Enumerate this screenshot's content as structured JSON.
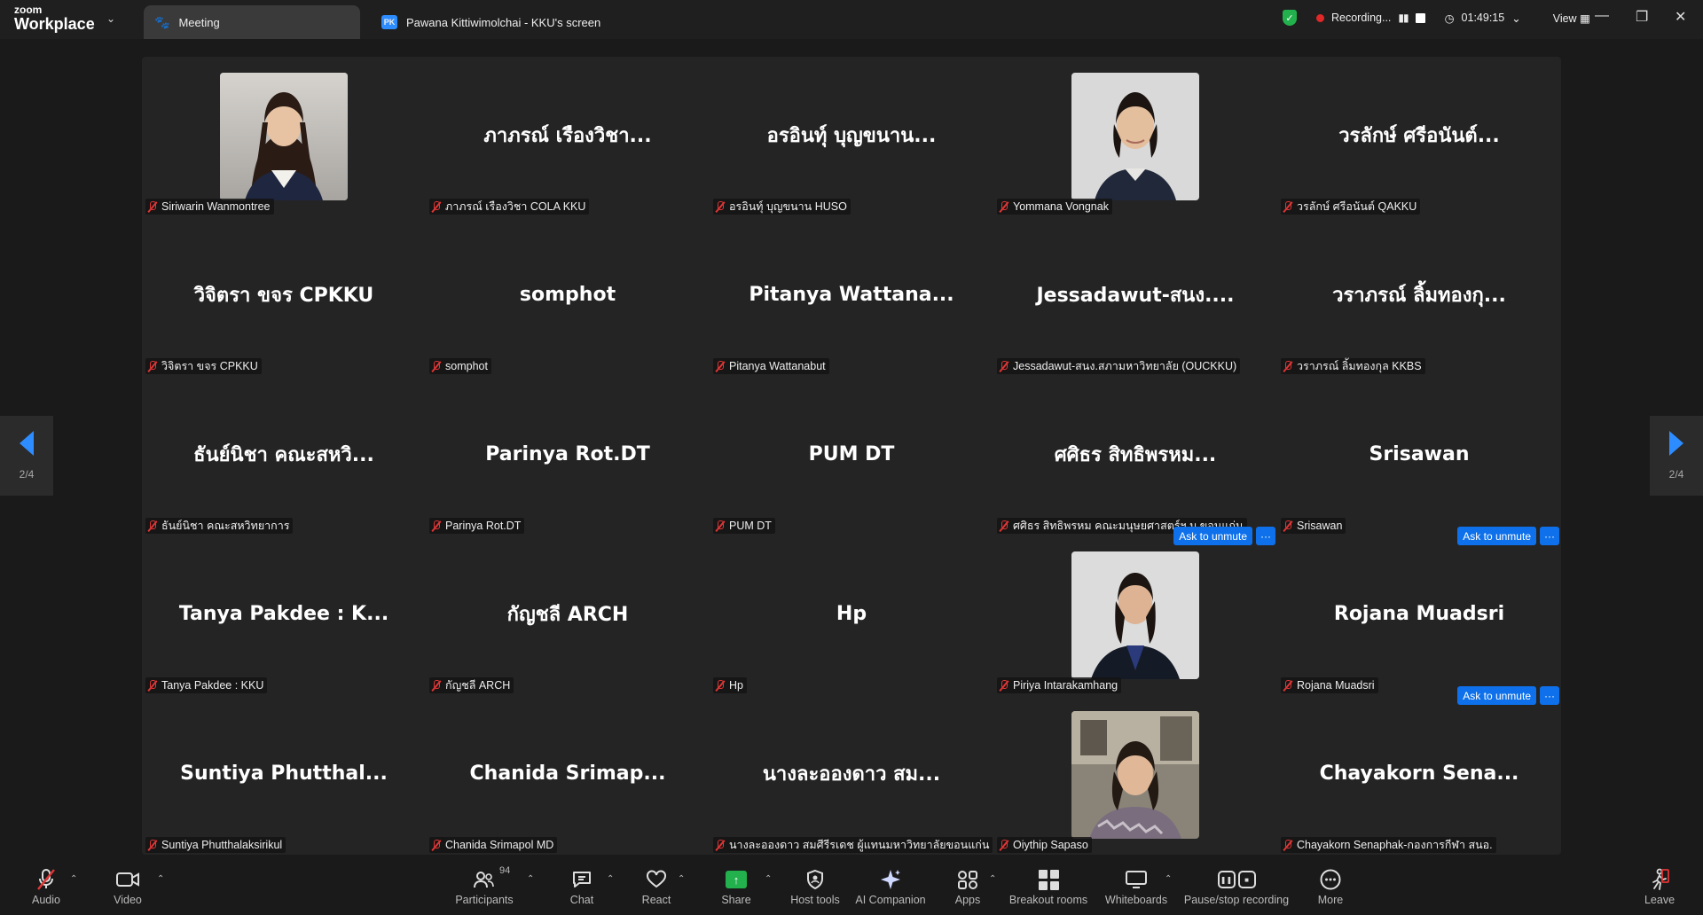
{
  "brand": {
    "line1": "zoom",
    "line2": "Workplace"
  },
  "tabs": [
    {
      "label": "Meeting"
    },
    {
      "label": "Pawana Kittiwimolchai - KKU's screen",
      "badge": "PK"
    }
  ],
  "recording": {
    "label": "Recording...",
    "timer": "01:49:15",
    "view_label": "View"
  },
  "pager": {
    "page": "2/4"
  },
  "ask_label": "Ask to unmute",
  "tiles": [
    {
      "big": "",
      "tag": "Siriwarin Wanmontree",
      "photo": "p1"
    },
    {
      "big": "ภาภรณ์ เรืองวิชา...",
      "tag": "ภาภรณ์ เรืองวิชา COLA KKU"
    },
    {
      "big": "อรอินทุ์ บุญขนาน...",
      "tag": "อรอินทุ์ บุญขนาน HUSO"
    },
    {
      "big": "",
      "tag": "Yommana Vongnak",
      "photo": "p2"
    },
    {
      "big": "วรลักษ์  ศรีอนันต์...",
      "tag": "วรลักษ์  ศรีอนันต์ QAKKU"
    },
    {
      "big": "วิจิตรา  ขจร CPKKU",
      "tag": "วิจิตรา  ขจร CPKKU"
    },
    {
      "big": "somphot",
      "tag": "somphot"
    },
    {
      "big": "Pitanya Wattana...",
      "tag": "Pitanya Wattanabut"
    },
    {
      "big": "Jessadawut-สนง....",
      "tag": "Jessadawut-สนง.สภามหาวิทยาลัย (OUCKKU)"
    },
    {
      "big": "วราภรณ์ ลิ้มทองกุ...",
      "tag": "วราภรณ์ ลิ้มทองกุล KKBS"
    },
    {
      "big": "ธันย์นิชา คณะสหวิ...",
      "tag": "ธันย์นิชา คณะสหวิทยาการ"
    },
    {
      "big": "Parinya Rot.DT",
      "tag": "Parinya Rot.DT"
    },
    {
      "big": "PUM DT",
      "tag": "PUM DT"
    },
    {
      "big": "ศศิธร สิทธิพรหม...",
      "tag": "ศศิธร สิทธิพรหม คณะมนุษยศาสตร์ฯ ม.ขอนแก่น"
    },
    {
      "big": "Srisawan",
      "tag": "Srisawan"
    },
    {
      "big": "Tanya Pakdee : K...",
      "tag": "Tanya Pakdee : KKU"
    },
    {
      "big": "กัญชลี ARCH",
      "tag": "กัญชลี ARCH"
    },
    {
      "big": "Hp",
      "tag": "Hp"
    },
    {
      "big": "",
      "tag": "Piriya Intarakamhang",
      "photo": "p3",
      "ask": true
    },
    {
      "big": "Rojana Muadsri",
      "tag": "Rojana Muadsri",
      "ask": true
    },
    {
      "big": "Suntiya  Phutthal...",
      "tag": "Suntiya Phutthalaksirikul"
    },
    {
      "big": "Chanida  Srimap...",
      "tag": "Chanida Srimapol MD"
    },
    {
      "big": "นางละอองดาว สม...",
      "tag": "นางละอองดาว สมศีรีรเดช ผู้แทนมหาวิทยาลัยขอนแก่น"
    },
    {
      "big": "",
      "tag": "Oiythip Sapaso",
      "photo": "p4"
    },
    {
      "big": "Chayakorn  Sena...",
      "tag": "Chayakorn Senaphak-กองการกีฬา สนอ.",
      "ask": true
    }
  ],
  "toolbar": {
    "audio": "Audio",
    "video": "Video",
    "participants": "Participants",
    "participants_count": "94",
    "chat": "Chat",
    "react": "React",
    "share": "Share",
    "host_tools": "Host tools",
    "ai_companion": "AI Companion",
    "apps": "Apps",
    "breakout": "Breakout rooms",
    "whiteboards": "Whiteboards",
    "pause_rec": "Pause/stop recording",
    "more": "More",
    "leave": "Leave"
  }
}
